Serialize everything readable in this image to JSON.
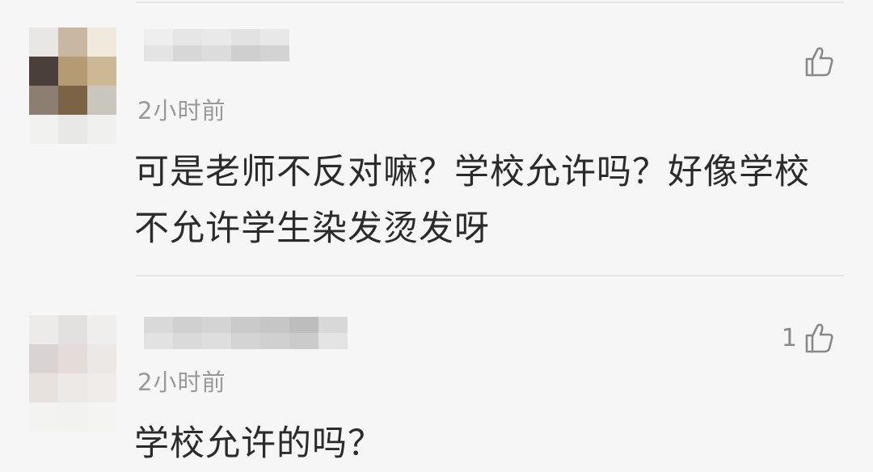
{
  "comments": [
    {
      "time": "2小时前",
      "text": "可是老师不反对嘛？学校允许吗？好像学校不允许学生染发烫发呀",
      "likes": "",
      "like_icon": "thumbs-up-outline-icon"
    },
    {
      "time": "2小时前",
      "text": "学校允许的吗？",
      "likes": "1",
      "like_icon": "thumbs-up-outline-icon"
    }
  ],
  "colors": {
    "background": "#f6f6f6",
    "divider": "#e6e6e6",
    "time_text": "#999999",
    "body_text": "#2b2b2b",
    "icon": "#888888"
  }
}
